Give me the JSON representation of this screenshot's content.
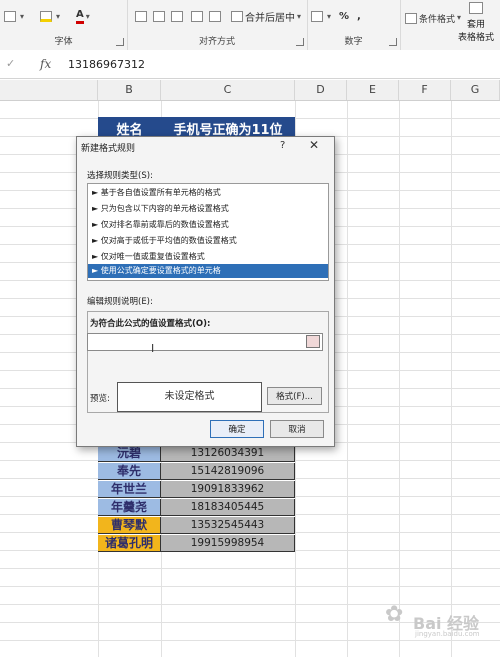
{
  "ribbon": {
    "groups": [
      {
        "label": "字体"
      },
      {
        "label": "对齐方式"
      },
      {
        "label": "数字"
      }
    ],
    "merge_center": "合并后居中",
    "percent": "%",
    "comma": ",",
    "conditional_format": "条件格式",
    "apply_label": "套用",
    "table_format": "表格格式"
  },
  "formula_bar": {
    "cancel": "✓",
    "fx": "fx",
    "value": "13186967312"
  },
  "columns": [
    "B",
    "C",
    "D",
    "E",
    "F",
    "G"
  ],
  "sheet": {
    "header": {
      "name": "姓名",
      "phone": "手机号正确为11位"
    },
    "rows": [
      {
        "name": "沅碧",
        "phone": "13126034391",
        "color": "#9dbbe3"
      },
      {
        "name": "奉先",
        "phone": "15142819096",
        "color": "#9dbbe3"
      },
      {
        "name": "年世兰",
        "phone": "19091833962",
        "color": "#9dbbe3"
      },
      {
        "name": "年羹尧",
        "phone": "18183405445",
        "color": "#9dbbe3"
      },
      {
        "name": "曹琴默",
        "phone": "13532545443",
        "color": "#f2b51c"
      },
      {
        "name": "诸葛孔明",
        "phone": "19915998954",
        "color": "#f2b51c"
      }
    ]
  },
  "dialog": {
    "title": "新建格式规则",
    "help": "?",
    "close": "✕",
    "select_type_label": "选择规则类型(S):",
    "rule_types": [
      "► 基于各自值设置所有单元格的格式",
      "► 只为包含以下内容的单元格设置格式",
      "► 仅对排名靠前或靠后的数值设置格式",
      "► 仅对高于或低于平均值的数值设置格式",
      "► 仅对唯一值或重复值设置格式",
      "► 使用公式确定要设置格式的单元格"
    ],
    "edit_label": "编辑规则说明(E):",
    "formula_label": "为符合此公式的值设置格式(O):",
    "formula_value": "",
    "cursor_glyph": "I",
    "preview_label": "预览:",
    "preview_text": "未设定格式",
    "format_button": "格式(F)...",
    "ok_button": "确定",
    "cancel_button": "取消"
  },
  "watermark": {
    "text": "Bai 经验",
    "sub": "jingyan.baidu.com"
  }
}
